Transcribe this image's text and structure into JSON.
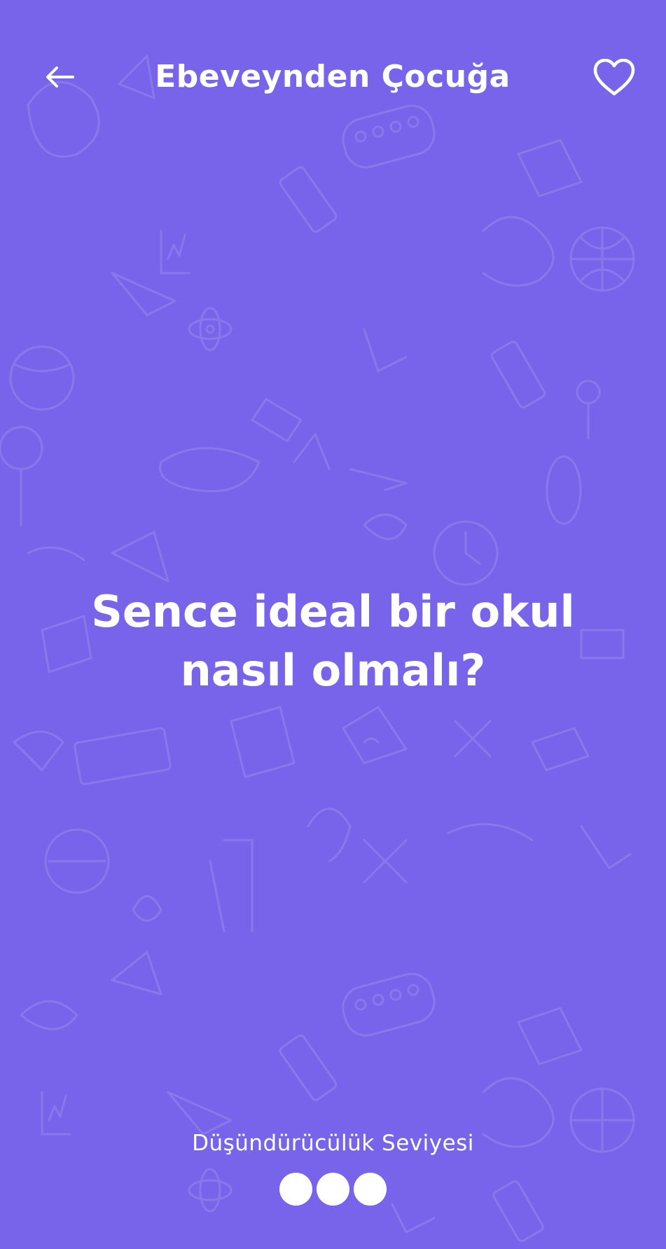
{
  "header": {
    "title": "Ebeveynden Çocuğa",
    "back_icon": "arrow-left-icon",
    "favorite_icon": "heart-outline-icon"
  },
  "card": {
    "question": "Sence ideal bir okul nasıl olmalı?",
    "background_color": "#7864ea",
    "text_color": "#ffffff"
  },
  "footer": {
    "level_label": "Düşündürücülük Seviyesi",
    "level_value": 3,
    "level_max": 3
  }
}
